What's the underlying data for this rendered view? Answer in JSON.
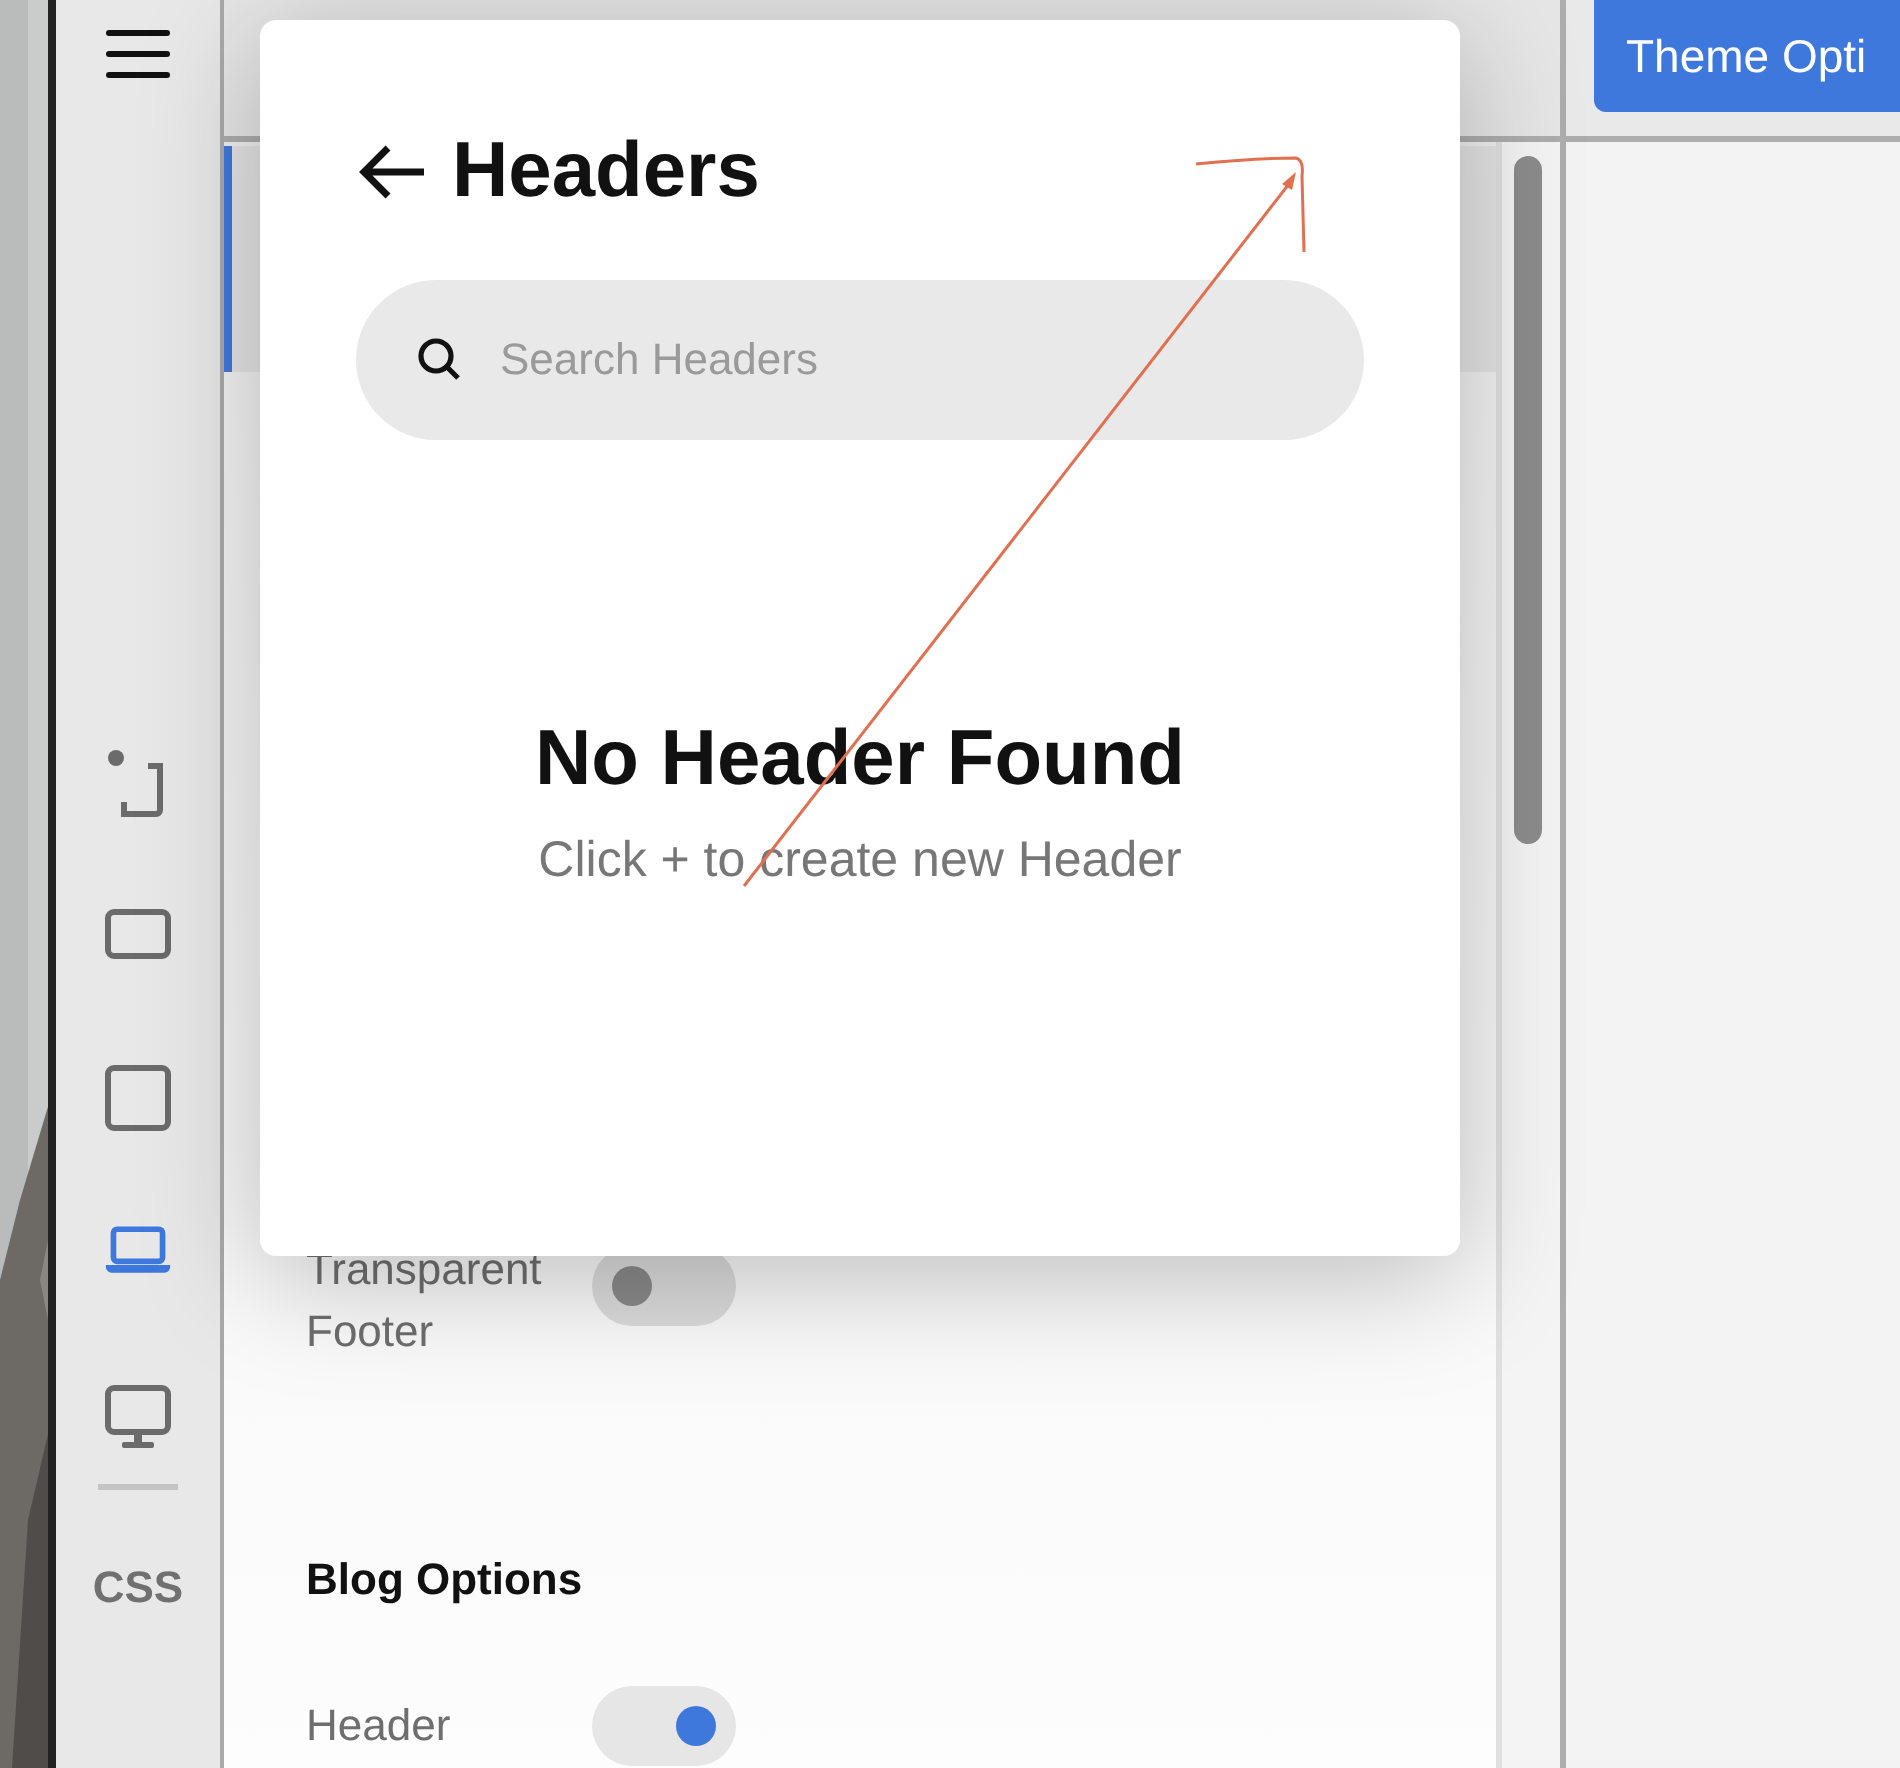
{
  "sidebar": {
    "devices": [
      {
        "kind": "rotate",
        "selected": false
      },
      {
        "kind": "landscape",
        "selected": false
      },
      {
        "kind": "square",
        "selected": false
      },
      {
        "kind": "laptop",
        "selected": true
      },
      {
        "kind": "monitor",
        "selected": false
      }
    ],
    "css_label": "CSS"
  },
  "toolbar": {
    "button": "Theme Opti"
  },
  "settings": [
    {
      "kind": "toggle",
      "label": "Transparent Footer",
      "on": false
    },
    {
      "kind": "heading",
      "label": "Blog Options"
    },
    {
      "kind": "toggle",
      "label": "Header",
      "on": true
    }
  ],
  "modal": {
    "title": "Headers",
    "search": {
      "placeholder": "Search Headers"
    },
    "empty_title": "No Header Found",
    "empty_hint": "Click + to create new Header"
  }
}
